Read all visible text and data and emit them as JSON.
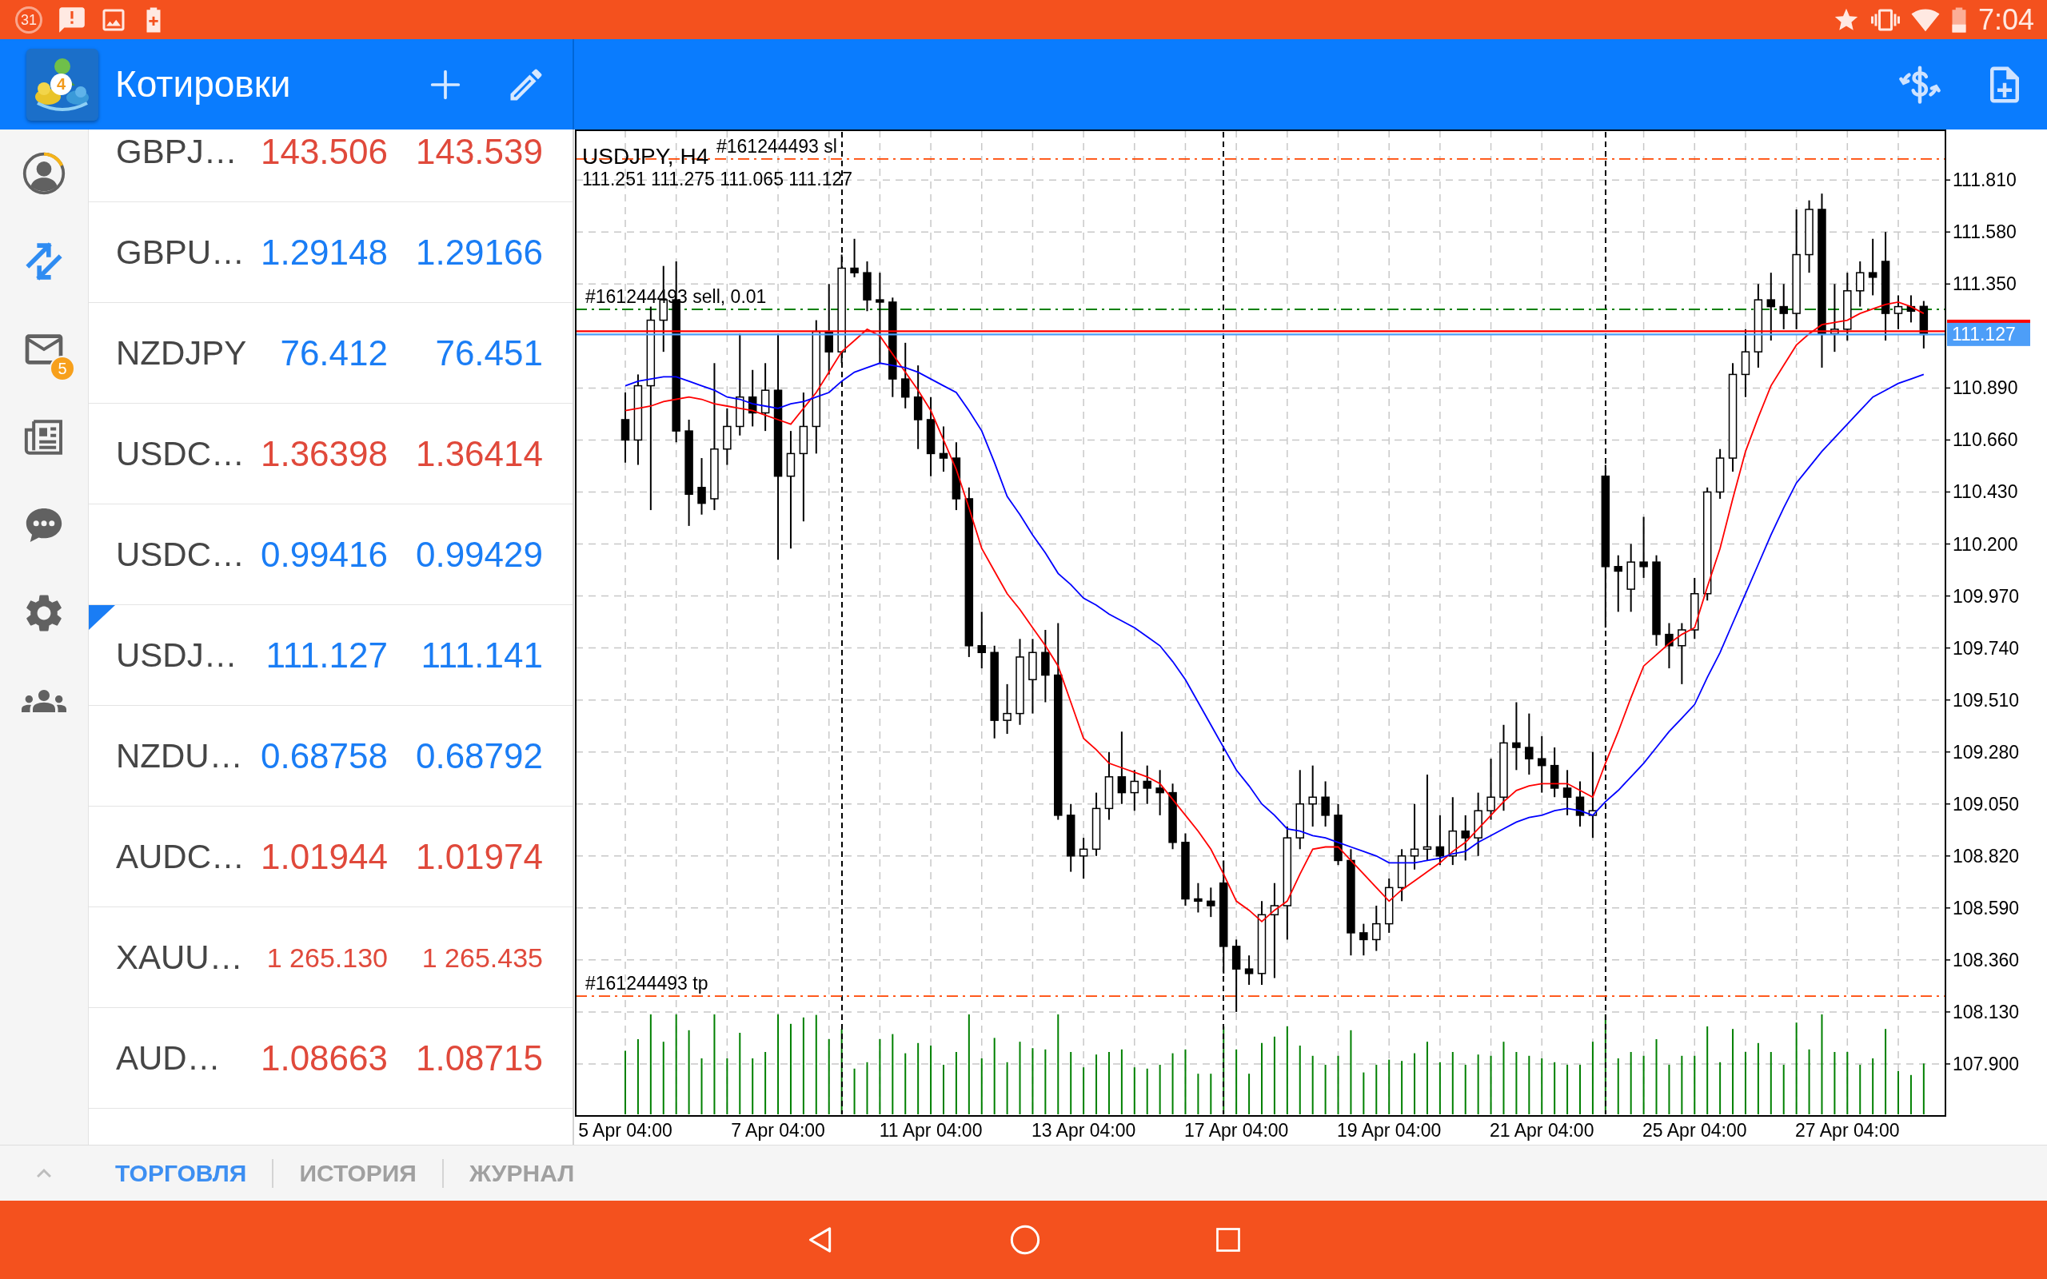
{
  "status_bar": {
    "calendar_day": "31",
    "time": "7:04"
  },
  "app_bar": {
    "logo_badge": "4",
    "title": "Котировки"
  },
  "sidebar": {
    "items": [
      {
        "selected": false
      },
      {
        "selected": true
      },
      {
        "selected": false,
        "badge": "5"
      },
      {
        "selected": false
      },
      {
        "selected": false
      },
      {
        "selected": false
      },
      {
        "selected": false
      }
    ]
  },
  "quotes": [
    {
      "symbol": "GBPJ…",
      "bid": "143.506",
      "ask": "143.539",
      "color": "#e0493b",
      "selected": false
    },
    {
      "symbol": "GBPU…",
      "bid": "1.29148",
      "ask": "1.29166",
      "color": "#1a7df5",
      "selected": false
    },
    {
      "symbol": "NZDJPY",
      "bid": "76.412",
      "ask": "76.451",
      "color": "#1a7df5",
      "selected": false
    },
    {
      "symbol": "USDC…",
      "bid": "1.36398",
      "ask": "1.36414",
      "color": "#e0493b",
      "selected": false
    },
    {
      "symbol": "USDC…",
      "bid": "0.99416",
      "ask": "0.99429",
      "color": "#1a7df5",
      "selected": false
    },
    {
      "symbol": "USDJ…",
      "bid": "111.127",
      "ask": "111.141",
      "color": "#1a7df5",
      "selected": true
    },
    {
      "symbol": "NZDU…",
      "bid": "0.68758",
      "ask": "0.68792",
      "color": "#1a7df5",
      "selected": false
    },
    {
      "symbol": "AUDC…",
      "bid": "1.01944",
      "ask": "1.01974",
      "color": "#e0493b",
      "selected": false
    },
    {
      "symbol": "XAUU…",
      "bid": "1 265.130",
      "ask": "1 265.435",
      "color": "#e0493b",
      "selected": false
    },
    {
      "symbol": "AUD…",
      "bid": "1.08663",
      "ask": "1.08715",
      "color": "#e0493b",
      "selected": false
    }
  ],
  "chart": {
    "chart_data": [
      {
        "type": "candlestick",
        "title": "USDJPY, H4",
        "subtitle": "111.251 111.275 111.065 111.127",
        "grid": true,
        "categories": [
          "5 Apr 04:00",
          null,
          null,
          null,
          null,
          null,
          null,
          null,
          null,
          null,
          null,
          null,
          "7 Apr 04:00",
          null,
          null,
          null,
          null,
          null,
          null,
          null,
          null,
          null,
          null,
          null,
          "11 Apr 04:00",
          null,
          null,
          null,
          null,
          null,
          null,
          null,
          null,
          null,
          null,
          null,
          "13 Apr 04:00",
          null,
          null,
          null,
          null,
          null,
          null,
          null,
          null,
          null,
          null,
          null,
          "17 Apr 04:00",
          null,
          null,
          null,
          null,
          null,
          null,
          null,
          null,
          null,
          null,
          null,
          "19 Apr 04:00",
          null,
          null,
          null,
          null,
          null,
          null,
          null,
          null,
          null,
          null,
          null,
          "21 Apr 04:00",
          null,
          null,
          null,
          null,
          null,
          null,
          null,
          null,
          null,
          null,
          null,
          "25 Apr 04:00",
          null,
          null,
          null,
          null,
          null,
          null,
          null,
          null,
          null,
          null,
          null,
          "27 Apr 04:00",
          null,
          null,
          null,
          null,
          null,
          null
        ],
        "ohlc": [
          [
            110.75,
            110.87,
            110.56,
            110.66
          ],
          [
            110.66,
            110.95,
            110.55,
            110.9
          ],
          [
            110.9,
            111.25,
            110.35,
            111.19
          ],
          [
            111.19,
            111.43,
            111.05,
            111.28
          ],
          [
            111.28,
            111.45,
            110.65,
            110.7
          ],
          [
            110.7,
            110.75,
            110.28,
            110.42
          ],
          [
            110.45,
            110.58,
            110.33,
            110.38
          ],
          [
            110.4,
            111.0,
            110.35,
            110.62
          ],
          [
            110.62,
            110.8,
            110.55,
            110.72
          ],
          [
            110.72,
            111.13,
            110.68,
            110.85
          ],
          [
            110.85,
            110.97,
            110.72,
            110.78
          ],
          [
            110.78,
            111.0,
            110.7,
            110.88
          ],
          [
            110.88,
            111.13,
            110.13,
            110.5
          ],
          [
            110.5,
            110.7,
            110.18,
            110.6
          ],
          [
            110.6,
            110.87,
            110.3,
            110.72
          ],
          [
            110.72,
            111.19,
            110.6,
            111.14
          ],
          [
            111.14,
            111.35,
            110.95,
            111.05
          ],
          [
            111.05,
            111.48,
            111.0,
            111.42
          ],
          [
            111.42,
            111.55,
            111.38,
            111.4
          ],
          [
            111.4,
            111.45,
            111.23,
            111.28
          ],
          [
            111.28,
            111.4,
            111.0,
            111.27
          ],
          [
            111.27,
            111.29,
            110.85,
            110.93
          ],
          [
            110.93,
            111.09,
            110.8,
            110.85
          ],
          [
            110.85,
            110.99,
            110.62,
            110.75
          ],
          [
            110.75,
            110.85,
            110.5,
            110.6
          ],
          [
            110.6,
            110.72,
            110.52,
            110.58
          ],
          [
            110.58,
            110.65,
            110.35,
            110.4
          ],
          [
            110.4,
            110.45,
            109.7,
            109.75
          ],
          [
            109.75,
            109.9,
            109.65,
            109.72
          ],
          [
            109.72,
            109.75,
            109.34,
            109.42
          ],
          [
            109.42,
            109.58,
            109.36,
            109.45
          ],
          [
            109.45,
            109.78,
            109.4,
            109.7
          ],
          [
            109.6,
            109.78,
            109.45,
            109.72
          ],
          [
            109.72,
            109.82,
            109.5,
            109.62
          ],
          [
            109.62,
            109.85,
            108.98,
            109.0
          ],
          [
            109.0,
            109.05,
            108.75,
            108.82
          ],
          [
            108.82,
            108.9,
            108.72,
            108.85
          ],
          [
            108.85,
            109.1,
            108.82,
            109.03
          ],
          [
            109.03,
            109.28,
            108.98,
            109.17
          ],
          [
            109.17,
            109.37,
            109.05,
            109.1
          ],
          [
            109.1,
            109.2,
            109.02,
            109.15
          ],
          [
            109.15,
            109.22,
            109.05,
            109.12
          ],
          [
            109.12,
            109.2,
            109.0,
            109.1
          ],
          [
            109.1,
            109.14,
            108.85,
            108.88
          ],
          [
            108.88,
            108.92,
            108.6,
            108.63
          ],
          [
            108.63,
            108.7,
            108.57,
            108.62
          ],
          [
            108.62,
            108.68,
            108.55,
            108.6
          ],
          [
            108.7,
            108.8,
            108.3,
            108.42
          ],
          [
            108.42,
            108.45,
            108.13,
            108.32
          ],
          [
            108.32,
            108.38,
            108.25,
            108.3
          ],
          [
            108.3,
            108.62,
            108.25,
            108.56
          ],
          [
            108.56,
            108.7,
            108.28,
            108.6
          ],
          [
            108.6,
            108.95,
            108.45,
            108.9
          ],
          [
            108.9,
            109.2,
            108.85,
            109.05
          ],
          [
            109.05,
            109.22,
            108.95,
            109.08
          ],
          [
            109.08,
            109.15,
            108.95,
            109.0
          ],
          [
            109.0,
            109.05,
            108.78,
            108.8
          ],
          [
            108.8,
            108.85,
            108.38,
            108.48
          ],
          [
            108.48,
            108.52,
            108.38,
            108.45
          ],
          [
            108.45,
            108.6,
            108.4,
            108.52
          ],
          [
            108.52,
            108.72,
            108.48,
            108.68
          ],
          [
            108.68,
            108.85,
            108.62,
            108.82
          ],
          [
            108.82,
            109.05,
            108.76,
            108.85
          ],
          [
            108.85,
            109.18,
            108.8,
            108.86
          ],
          [
            108.86,
            109.0,
            108.78,
            108.82
          ],
          [
            108.82,
            109.08,
            108.78,
            108.93
          ],
          [
            108.93,
            109.0,
            108.8,
            108.9
          ],
          [
            108.9,
            109.1,
            108.82,
            109.02
          ],
          [
            109.02,
            109.25,
            108.98,
            109.08
          ],
          [
            109.08,
            109.4,
            109.02,
            109.32
          ],
          [
            109.32,
            109.5,
            109.2,
            109.3
          ],
          [
            109.3,
            109.45,
            109.18,
            109.25
          ],
          [
            109.25,
            109.35,
            109.1,
            109.22
          ],
          [
            109.22,
            109.3,
            109.08,
            109.12
          ],
          [
            109.12,
            109.2,
            109.0,
            109.08
          ],
          [
            109.08,
            109.15,
            108.95,
            109.0
          ],
          [
            109.0,
            109.28,
            108.9,
            109.02
          ],
          [
            110.5,
            110.55,
            109.83,
            110.1
          ],
          [
            110.1,
            110.15,
            109.9,
            110.08
          ],
          [
            110.0,
            110.2,
            109.9,
            110.12
          ],
          [
            110.12,
            110.32,
            110.05,
            110.1
          ],
          [
            110.12,
            110.15,
            109.75,
            109.8
          ],
          [
            109.8,
            109.85,
            109.65,
            109.75
          ],
          [
            109.75,
            109.85,
            109.58,
            109.82
          ],
          [
            109.82,
            110.05,
            109.78,
            109.98
          ],
          [
            109.98,
            110.45,
            109.95,
            110.43
          ],
          [
            110.43,
            110.62,
            110.4,
            110.58
          ],
          [
            110.58,
            111.0,
            110.52,
            110.95
          ],
          [
            110.95,
            111.15,
            110.85,
            111.05
          ],
          [
            111.05,
            111.35,
            110.98,
            111.28
          ],
          [
            111.28,
            111.4,
            111.1,
            111.25
          ],
          [
            111.25,
            111.35,
            111.15,
            111.22
          ],
          [
            111.22,
            111.68,
            111.15,
            111.48
          ],
          [
            111.48,
            111.72,
            111.4,
            111.68
          ],
          [
            111.68,
            111.75,
            110.98,
            111.13
          ],
          [
            111.13,
            111.35,
            111.05,
            111.15
          ],
          [
            111.15,
            111.4,
            111.1,
            111.32
          ],
          [
            111.32,
            111.45,
            111.25,
            111.4
          ],
          [
            111.4,
            111.55,
            111.3,
            111.38
          ],
          [
            111.45,
            111.58,
            111.1,
            111.22
          ],
          [
            111.22,
            111.3,
            111.15,
            111.25
          ],
          [
            111.25,
            111.3,
            111.18,
            111.23
          ],
          [
            111.251,
            111.275,
            111.065,
            111.127
          ]
        ],
        "series": [
          {
            "type": "line",
            "color": "#ff0000",
            "values": [
              110.79,
              110.8,
              110.81,
              110.83,
              110.84,
              110.85,
              110.84,
              110.82,
              110.81,
              110.8,
              110.79,
              110.77,
              110.75,
              110.73,
              110.8,
              110.87,
              110.96,
              111.05,
              111.1,
              111.15,
              111.12,
              111.04,
              110.96,
              110.88,
              110.79,
              110.66,
              110.53,
              110.36,
              110.18,
              110.08,
              109.98,
              109.91,
              109.83,
              109.75,
              109.66,
              109.5,
              109.34,
              109.29,
              109.23,
              109.21,
              109.19,
              109.17,
              109.14,
              109.07,
              109.0,
              108.93,
              108.85,
              108.74,
              108.62,
              108.58,
              108.53,
              108.58,
              108.62,
              108.74,
              108.85,
              108.86,
              108.86,
              108.8,
              108.74,
              108.68,
              108.62,
              108.67,
              108.71,
              108.75,
              108.79,
              108.84,
              108.88,
              108.94,
              109.0,
              109.06,
              109.11,
              109.13,
              109.14,
              109.14,
              109.14,
              109.11,
              109.08,
              109.23,
              109.37,
              109.52,
              109.66,
              109.71,
              109.76,
              109.8,
              109.83,
              110.01,
              110.18,
              110.4,
              110.61,
              110.76,
              110.9,
              110.99,
              111.08,
              111.13,
              111.17,
              111.18,
              111.19,
              111.22,
              111.24,
              111.26,
              111.27,
              111.25,
              111.22
            ]
          },
          {
            "type": "line",
            "color": "#0000ff",
            "values": [
              110.9,
              110.92,
              110.93,
              110.94,
              110.94,
              110.92,
              110.9,
              110.88,
              110.85,
              110.84,
              110.82,
              110.81,
              110.8,
              110.82,
              110.83,
              110.85,
              110.87,
              110.92,
              110.96,
              110.98,
              111.0,
              110.99,
              110.98,
              110.96,
              110.93,
              110.9,
              110.87,
              110.79,
              110.7,
              110.56,
              110.41,
              110.33,
              110.24,
              110.16,
              110.07,
              110.02,
              109.96,
              109.93,
              109.89,
              109.86,
              109.83,
              109.79,
              109.75,
              109.68,
              109.6,
              109.5,
              109.4,
              109.3,
              109.2,
              109.13,
              109.05,
              109.0,
              108.94,
              108.93,
              108.91,
              108.9,
              108.88,
              108.86,
              108.84,
              108.82,
              108.79,
              108.79,
              108.79,
              108.8,
              108.81,
              108.83,
              108.84,
              108.88,
              108.91,
              108.94,
              108.97,
              108.99,
              109.0,
              109.02,
              109.03,
              109.02,
              109.0,
              109.06,
              109.11,
              109.17,
              109.23,
              109.3,
              109.37,
              109.43,
              109.49,
              109.61,
              109.72,
              109.85,
              109.98,
              110.11,
              110.24,
              110.36,
              110.47,
              110.54,
              110.61,
              110.67,
              110.73,
              110.79,
              110.85,
              110.88,
              110.91,
              110.93,
              110.95
            ]
          }
        ],
        "ylim": [
          107.67,
          112.03
        ],
        "yticks": [
          {
            "value": 111.81,
            "label": "111.810"
          },
          {
            "value": 111.58,
            "label": "111.580"
          },
          {
            "value": 111.35,
            "label": "111.350"
          },
          {
            "value": 110.89,
            "label": "110.890"
          },
          {
            "value": 110.66,
            "label": "110.660"
          },
          {
            "value": 110.43,
            "label": "110.430"
          },
          {
            "value": 110.2,
            "label": "110.200"
          },
          {
            "value": 109.97,
            "label": "109.970"
          },
          {
            "value": 109.74,
            "label": "109.740"
          },
          {
            "value": 109.51,
            "label": "109.510"
          },
          {
            "value": 109.28,
            "label": "109.280"
          },
          {
            "value": 109.05,
            "label": "109.050"
          },
          {
            "value": 108.82,
            "label": "108.820"
          },
          {
            "value": 108.59,
            "label": "108.590"
          },
          {
            "value": 108.36,
            "label": "108.360"
          },
          {
            "value": 108.13,
            "label": "108.130"
          },
          {
            "value": 107.9,
            "label": "107.900"
          }
        ],
        "ref_lines": [
          {
            "axis": "y",
            "value": 111.903,
            "label": "#161244493 sl",
            "color": "#ff4500",
            "line_style": "dashdot"
          },
          {
            "axis": "y",
            "value": 111.238,
            "label": "#161244493 sell, 0.01",
            "color": "#008000",
            "line_style": "dashdot"
          },
          {
            "axis": "y",
            "value": 108.2,
            "label": "#161244493 tp",
            "color": "#ff4500",
            "line_style": "dashdot"
          },
          {
            "axis": "y",
            "value": 111.141,
            "color": "#ff0000",
            "line_style": "solid"
          },
          {
            "axis": "y",
            "value": 111.127,
            "label": "111.127",
            "color": "#4d9ef8",
            "line_style": "solid"
          }
        ]
      }
    ]
  },
  "bottom_tabs": [
    {
      "label": "ТОРГОВЛЯ",
      "selected": true
    },
    {
      "label": "ИСТОРИЯ",
      "selected": false
    },
    {
      "label": "ЖУРНАЛ",
      "selected": false
    }
  ]
}
